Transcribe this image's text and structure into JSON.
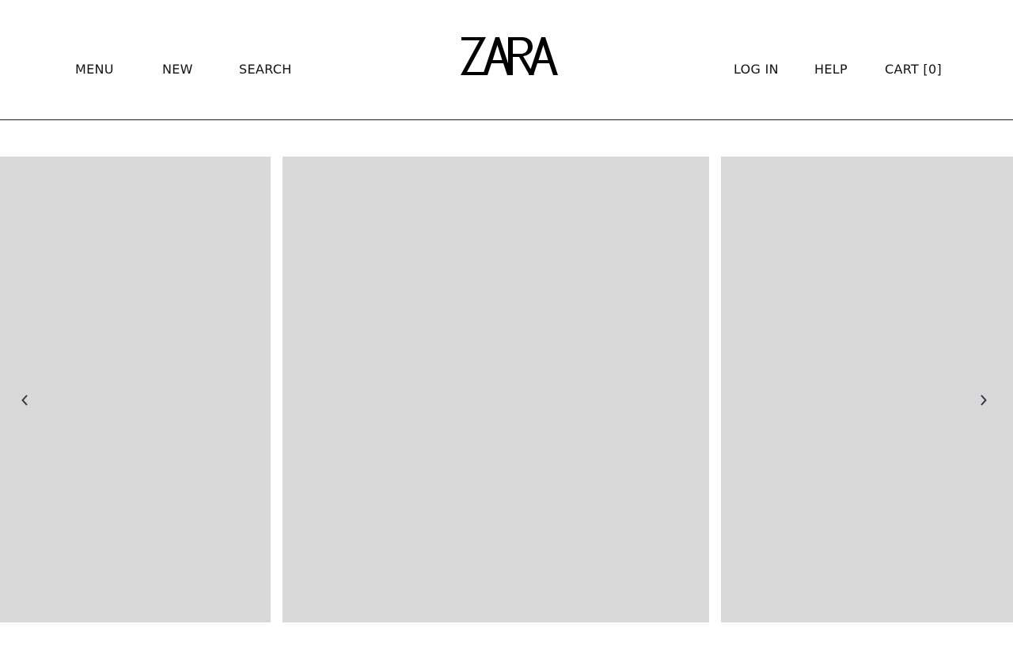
{
  "header": {
    "nav_left": {
      "menu": "MENU",
      "new": "NEW",
      "search": "SEARCH"
    },
    "logo": "ZARA",
    "nav_right": {
      "login": "LOG IN",
      "help": "HELP",
      "cart": "CART [0]"
    }
  },
  "carousel": {
    "slide_count": 3,
    "placeholder_color": "#d9d9d9",
    "arrow_color": "#2f3a45",
    "prev_icon": "chevron-left-icon",
    "next_icon": "chevron-right-icon"
  },
  "colors": {
    "text": "#111111",
    "divider": "#1a1a1a",
    "background": "#ffffff"
  }
}
